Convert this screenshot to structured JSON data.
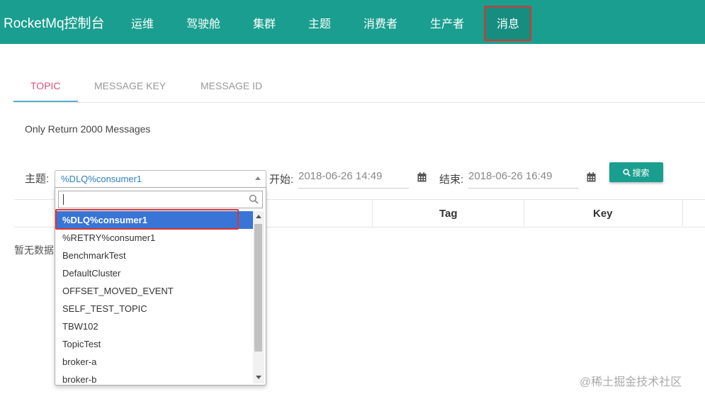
{
  "navbar": {
    "brand": "RocketMq控制台",
    "items": [
      "运维",
      "驾驶舱",
      "集群",
      "主题",
      "消费者",
      "生产者",
      "消息"
    ],
    "active": "消息"
  },
  "tabs": [
    {
      "label": "TOPIC",
      "active": true
    },
    {
      "label": "MESSAGE KEY",
      "active": false
    },
    {
      "label": "MESSAGE ID",
      "active": false
    }
  ],
  "notice": "Only Return 2000 Messages",
  "form": {
    "topic_label": "主题:",
    "topic_value": "%DLQ%consumer1",
    "start_label": "开始:",
    "start_value": "2018-06-26 14:49",
    "end_label": "结束:",
    "end_value": "2018-06-26 16:49",
    "search_label": "搜索"
  },
  "dropdown": {
    "search_value": "",
    "options": [
      "%DLQ%consumer1",
      "%RETRY%consumer1",
      "BenchmarkTest",
      "DefaultCluster",
      "OFFSET_MOVED_EVENT",
      "SELF_TEST_TOPIC",
      "TBW102",
      "TopicTest",
      "broker-a",
      "broker-b"
    ],
    "selected": "%DLQ%consumer1"
  },
  "table": {
    "headers": [
      "",
      "Tag",
      "Key"
    ],
    "empty_text": "暂无数据"
  },
  "watermark": "@稀土掘金技术社区",
  "colors": {
    "brand": "#1a9e8f",
    "highlight": "#e0322d",
    "selected": "#3875d7",
    "tab_active": "#e0507a"
  }
}
